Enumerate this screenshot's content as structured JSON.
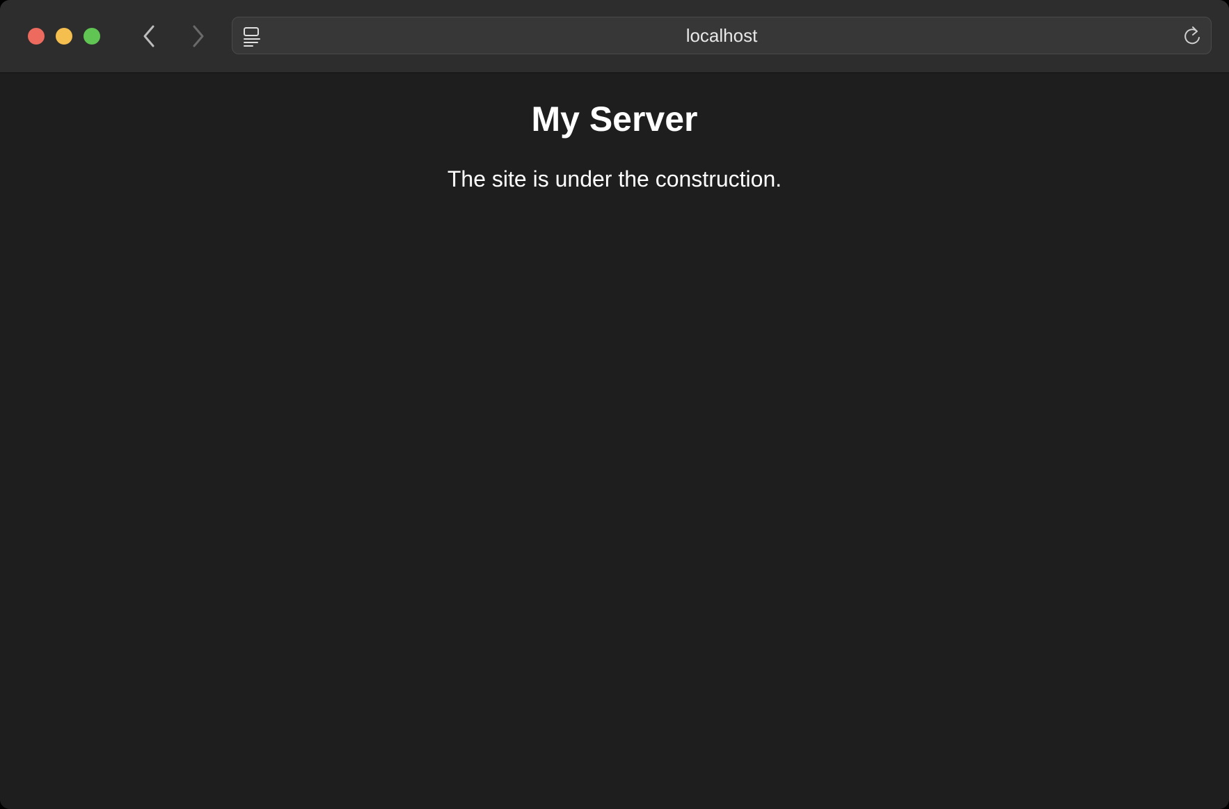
{
  "browser": {
    "address": "localhost",
    "icons": {
      "back": "chevron-left-icon",
      "forward": "chevron-right-icon",
      "reader": "reader-mode-icon",
      "reload": "reload-icon"
    },
    "traffic_lights": {
      "close": "#ed6a5e",
      "minimize": "#f5bf4f",
      "zoom": "#61c554"
    }
  },
  "page": {
    "heading": "My Server",
    "message": "The site is under the construction."
  }
}
